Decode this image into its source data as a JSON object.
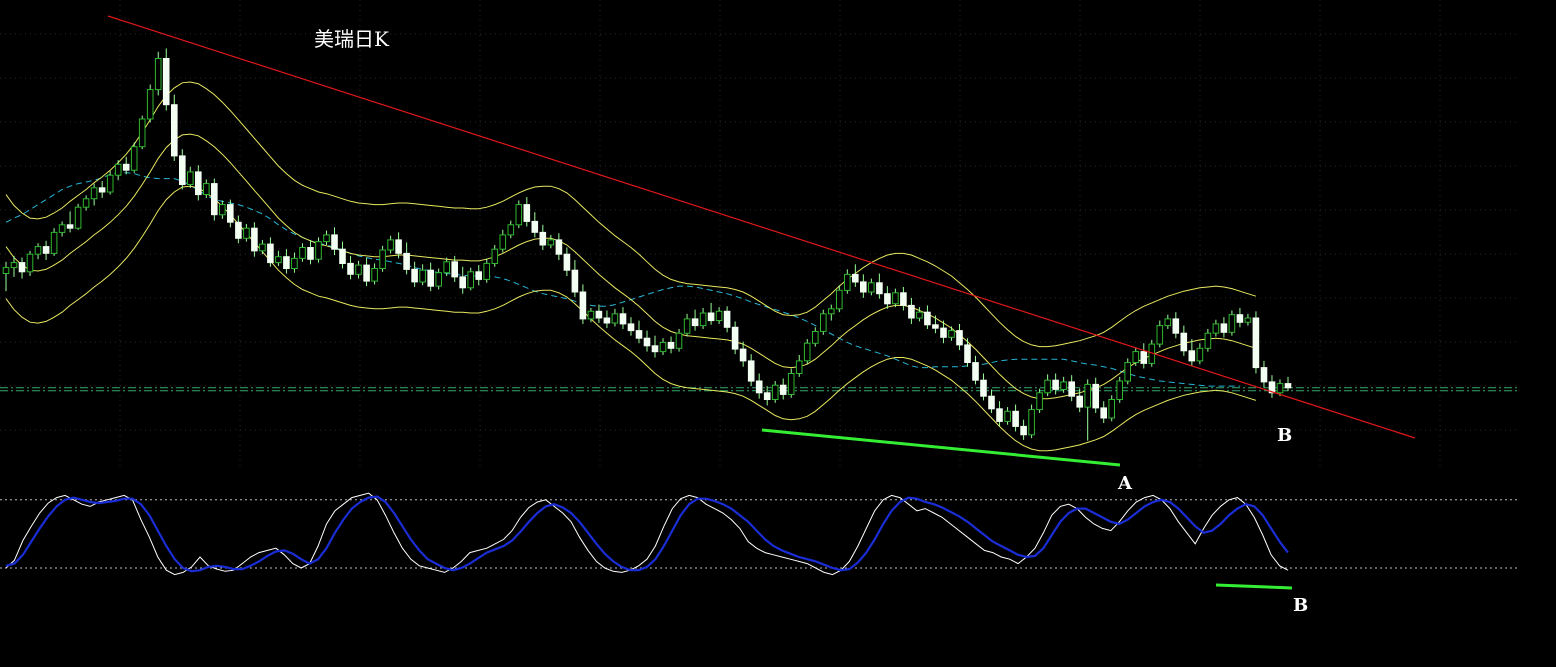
{
  "chart_data": {
    "type": "candlestick",
    "title": "美瑞日K",
    "annotations": {
      "main_a": "A",
      "main_b": "B",
      "osc_b": "B"
    },
    "colors": {
      "background": "#000000",
      "up_candle": "#2db82d",
      "down_candle": "#f2fff2",
      "wick": "#9aff9a",
      "bollinger_band": "#e8e860",
      "moving_average": "#26b6d6",
      "trendline": "#e01818",
      "divergence_line": "#33ee33",
      "oscillator_fast": "#ffffff",
      "oscillator_slow": "#1a2dd6",
      "grid": "#2a2a2a",
      "level_line": "#35a86b"
    },
    "candles": [
      [
        100.2,
        101.6,
        98.1,
        100.9
      ],
      [
        100.9,
        102.3,
        99.8,
        101.5
      ],
      [
        101.5,
        102.1,
        99.6,
        100.4
      ],
      [
        100.4,
        102.9,
        99.9,
        102.5
      ],
      [
        102.5,
        103.8,
        101.9,
        103.4
      ],
      [
        103.4,
        104.1,
        101.8,
        102.6
      ],
      [
        102.6,
        105.6,
        102.3,
        105.1
      ],
      [
        105.1,
        106.4,
        104.6,
        106.0
      ],
      [
        106.0,
        107.6,
        105.1,
        105.6
      ],
      [
        105.6,
        108.5,
        105.4,
        108.1
      ],
      [
        108.1,
        109.5,
        107.7,
        109.1
      ],
      [
        109.1,
        110.9,
        108.3,
        110.4
      ],
      [
        110.4,
        111.2,
        109.2,
        109.9
      ],
      [
        109.9,
        112.4,
        109.6,
        111.9
      ],
      [
        111.9,
        113.7,
        111.3,
        113.2
      ],
      [
        113.2,
        114.1,
        112.0,
        112.5
      ],
      [
        112.5,
        115.8,
        112.2,
        115.3
      ],
      [
        115.3,
        119.0,
        115.0,
        118.6
      ],
      [
        118.6,
        122.7,
        118.2,
        122.1
      ],
      [
        122.1,
        126.6,
        121.4,
        125.8
      ],
      [
        125.8,
        127.0,
        119.6,
        120.3
      ],
      [
        120.3,
        121.5,
        113.6,
        114.2
      ],
      [
        114.2,
        115.0,
        110.2,
        110.8
      ],
      [
        110.8,
        112.9,
        110.4,
        112.3
      ],
      [
        112.3,
        113.1,
        108.9,
        109.6
      ],
      [
        109.6,
        111.4,
        109.2,
        110.9
      ],
      [
        110.9,
        111.5,
        106.5,
        107.2
      ],
      [
        107.2,
        108.9,
        106.7,
        108.4
      ],
      [
        108.4,
        109.0,
        105.7,
        106.3
      ],
      [
        106.3,
        107.1,
        103.8,
        104.4
      ],
      [
        104.4,
        106.1,
        104.0,
        105.6
      ],
      [
        105.6,
        106.3,
        102.2,
        102.9
      ],
      [
        102.9,
        104.2,
        102.5,
        103.7
      ],
      [
        103.7,
        104.5,
        101.0,
        101.5
      ],
      [
        101.5,
        102.9,
        101.1,
        102.2
      ],
      [
        102.2,
        103.1,
        100.2,
        100.8
      ],
      [
        100.8,
        102.7,
        100.3,
        102.0
      ],
      [
        102.0,
        103.8,
        101.6,
        103.3
      ],
      [
        103.3,
        104.2,
        101.3,
        101.9
      ],
      [
        101.9,
        104.5,
        101.5,
        104.0
      ],
      [
        104.0,
        105.3,
        103.6,
        104.8
      ],
      [
        104.8,
        105.7,
        102.4,
        103.1
      ],
      [
        103.1,
        104.0,
        100.8,
        101.4
      ],
      [
        101.4,
        102.3,
        99.5,
        100.1
      ],
      [
        100.1,
        101.7,
        99.6,
        101.2
      ],
      [
        101.2,
        102.1,
        98.7,
        99.3
      ],
      [
        99.3,
        101.4,
        98.9,
        100.8
      ],
      [
        100.8,
        103.5,
        100.4,
        103.0
      ],
      [
        103.0,
        104.7,
        102.6,
        104.2
      ],
      [
        104.2,
        105.1,
        102.0,
        102.6
      ],
      [
        102.6,
        103.9,
        100.1,
        100.7
      ],
      [
        100.7,
        101.6,
        98.6,
        99.2
      ],
      [
        99.2,
        101.3,
        98.8,
        100.6
      ],
      [
        100.6,
        101.5,
        98.1,
        98.7
      ],
      [
        98.7,
        100.8,
        98.3,
        100.3
      ],
      [
        100.3,
        102.1,
        99.9,
        101.6
      ],
      [
        101.6,
        102.3,
        99.2,
        99.8
      ],
      [
        99.8,
        101.0,
        97.8,
        98.5
      ],
      [
        98.5,
        100.9,
        98.2,
        100.4
      ],
      [
        100.4,
        101.2,
        98.8,
        99.5
      ],
      [
        99.5,
        102.0,
        99.1,
        101.4
      ],
      [
        101.4,
        103.6,
        101.0,
        103.1
      ],
      [
        103.1,
        105.4,
        102.7,
        104.8
      ],
      [
        104.8,
        106.5,
        104.4,
        106.0
      ],
      [
        106.0,
        108.9,
        105.6,
        108.4
      ],
      [
        108.4,
        109.3,
        105.8,
        106.4
      ],
      [
        106.4,
        107.5,
        104.5,
        105.1
      ],
      [
        105.1,
        106.0,
        103.0,
        103.6
      ],
      [
        103.6,
        104.8,
        103.2,
        104.2
      ],
      [
        104.2,
        105.0,
        101.8,
        102.5
      ],
      [
        102.5,
        103.3,
        99.9,
        100.6
      ],
      [
        100.6,
        101.8,
        97.4,
        98.0
      ],
      [
        98.0,
        98.9,
        94.2,
        94.8
      ],
      [
        94.8,
        96.1,
        94.4,
        95.7
      ],
      [
        95.7,
        96.5,
        94.3,
        94.9
      ],
      [
        94.9,
        95.8,
        93.7,
        94.3
      ],
      [
        94.3,
        96.0,
        93.9,
        95.4
      ],
      [
        95.4,
        96.2,
        93.6,
        94.2
      ],
      [
        94.2,
        95.0,
        92.8,
        93.4
      ],
      [
        93.4,
        94.6,
        91.9,
        92.5
      ],
      [
        92.5,
        93.4,
        90.9,
        91.6
      ],
      [
        91.6,
        92.8,
        90.2,
        90.9
      ],
      [
        90.9,
        92.5,
        90.5,
        92.0
      ],
      [
        92.0,
        92.7,
        90.7,
        91.3
      ],
      [
        91.3,
        93.6,
        90.9,
        93.1
      ],
      [
        93.1,
        95.4,
        92.7,
        94.8
      ],
      [
        94.8,
        95.9,
        93.4,
        94.0
      ],
      [
        94.0,
        96.1,
        93.6,
        95.5
      ],
      [
        95.5,
        96.7,
        94.1,
        94.6
      ],
      [
        94.6,
        96.2,
        94.2,
        95.7
      ],
      [
        95.7,
        96.3,
        93.2,
        93.8
      ],
      [
        93.8,
        94.5,
        90.6,
        91.2
      ],
      [
        91.2,
        92.1,
        89.1,
        89.8
      ],
      [
        89.8,
        90.6,
        86.8,
        87.4
      ],
      [
        87.4,
        88.3,
        85.3,
        86.0
      ],
      [
        86.0,
        86.8,
        84.5,
        85.2
      ],
      [
        85.2,
        87.4,
        84.8,
        86.9
      ],
      [
        86.9,
        87.7,
        85.2,
        85.8
      ],
      [
        85.8,
        88.9,
        85.4,
        88.3
      ],
      [
        88.3,
        90.5,
        87.9,
        89.8
      ],
      [
        89.8,
        92.4,
        89.4,
        91.9
      ],
      [
        91.9,
        93.8,
        91.5,
        93.3
      ],
      [
        93.3,
        95.9,
        92.9,
        95.4
      ],
      [
        95.4,
        96.5,
        94.6,
        96.0
      ],
      [
        96.0,
        98.8,
        95.6,
        98.2
      ],
      [
        98.2,
        100.7,
        97.8,
        100.1
      ],
      [
        100.1,
        101.3,
        98.6,
        99.2
      ],
      [
        99.2,
        100.1,
        97.3,
        98.0
      ],
      [
        98.0,
        99.6,
        97.6,
        99.1
      ],
      [
        99.1,
        100.2,
        97.2,
        97.8
      ],
      [
        97.8,
        98.7,
        96.0,
        96.6
      ],
      [
        96.6,
        98.4,
        96.2,
        97.9
      ],
      [
        97.9,
        98.6,
        95.8,
        96.4
      ],
      [
        96.4,
        97.3,
        94.2,
        94.9
      ],
      [
        94.9,
        96.2,
        94.5,
        95.6
      ],
      [
        95.6,
        96.4,
        93.6,
        94.1
      ],
      [
        94.1,
        95.2,
        93.1,
        93.7
      ],
      [
        93.7,
        94.6,
        91.9,
        92.6
      ],
      [
        92.6,
        93.9,
        92.2,
        93.4
      ],
      [
        93.4,
        94.2,
        91.1,
        91.7
      ],
      [
        91.7,
        92.5,
        89.1,
        89.6
      ],
      [
        89.6,
        90.4,
        87.0,
        87.5
      ],
      [
        87.5,
        88.3,
        85.1,
        85.6
      ],
      [
        85.6,
        86.4,
        83.6,
        84.1
      ],
      [
        84.1,
        85.0,
        82.0,
        82.6
      ],
      [
        82.6,
        84.3,
        82.2,
        83.8
      ],
      [
        83.8,
        84.6,
        81.4,
        82.0
      ],
      [
        82.0,
        82.8,
        80.4,
        81.0
      ],
      [
        81.0,
        84.6,
        80.6,
        84.0
      ],
      [
        84.0,
        86.5,
        83.6,
        86.0
      ],
      [
        86.0,
        88.2,
        85.6,
        87.5
      ],
      [
        87.5,
        88.3,
        85.8,
        86.4
      ],
      [
        86.4,
        87.9,
        86.0,
        87.3
      ],
      [
        87.3,
        88.1,
        85.0,
        85.6
      ],
      [
        85.6,
        86.5,
        83.7,
        84.3
      ],
      [
        84.3,
        87.6,
        80.3,
        87.0
      ],
      [
        87.0,
        87.8,
        83.6,
        84.2
      ],
      [
        84.2,
        85.0,
        82.4,
        83.0
      ],
      [
        83.0,
        85.7,
        82.6,
        85.2
      ],
      [
        85.2,
        87.9,
        84.8,
        87.4
      ],
      [
        87.4,
        90.1,
        87.0,
        89.6
      ],
      [
        89.6,
        91.4,
        89.2,
        90.9
      ],
      [
        90.9,
        91.9,
        88.9,
        89.5
      ],
      [
        89.5,
        92.3,
        89.1,
        91.8
      ],
      [
        91.8,
        94.6,
        91.4,
        94.0
      ],
      [
        94.0,
        95.3,
        93.6,
        94.8
      ],
      [
        94.8,
        95.6,
        92.5,
        93.1
      ],
      [
        93.1,
        94.0,
        90.4,
        91.0
      ],
      [
        91.0,
        92.4,
        89.2,
        89.8
      ],
      [
        89.8,
        91.9,
        89.4,
        91.3
      ],
      [
        91.3,
        93.6,
        90.9,
        93.1
      ],
      [
        93.1,
        94.7,
        92.7,
        94.2
      ],
      [
        94.2,
        95.0,
        92.6,
        93.2
      ],
      [
        93.2,
        95.8,
        92.8,
        95.3
      ],
      [
        95.3,
        96.1,
        93.8,
        94.4
      ],
      [
        94.4,
        95.4,
        94.0,
        94.9
      ],
      [
        94.9,
        95.7,
        88.3,
        89.0
      ],
      [
        89.0,
        89.8,
        86.6,
        87.3
      ],
      [
        87.3,
        88.1,
        85.4,
        86.0
      ],
      [
        86.0,
        87.6,
        85.6,
        87.1
      ],
      [
        87.1,
        87.9,
        86.2,
        86.6
      ]
    ],
    "ma_mid": [
      106.3,
      106.8,
      107.2,
      107.8,
      108.4,
      109.0,
      109.6,
      110.2,
      110.6,
      110.9,
      111.1,
      111.3,
      111.6,
      112.0,
      112.2,
      112.2,
      112.1,
      111.8,
      111.6,
      111.5,
      111.5,
      111.5,
      111.2,
      110.7,
      110.1,
      109.5,
      109.0,
      108.8,
      108.6,
      108.4,
      108.1,
      107.7,
      107.3,
      106.7,
      106.0,
      105.4,
      104.9,
      104.5,
      104.1,
      103.8,
      103.6,
      103.3,
      103.0,
      102.6,
      102.3,
      102.1,
      101.9,
      101.8,
      101.6,
      101.4,
      101.2,
      100.9,
      100.7,
      100.5,
      100.3,
      100.2,
      100.1,
      100.0,
      99.9,
      99.9,
      99.9,
      99.8,
      99.6,
      99.3,
      98.9,
      98.5,
      98.1,
      97.8,
      97.6,
      97.4,
      97.2,
      96.9,
      96.6,
      96.4,
      96.3,
      96.3,
      96.5,
      96.8,
      97.1,
      97.4,
      97.7,
      98.0,
      98.3,
      98.5,
      98.7,
      98.7,
      98.6,
      98.4,
      98.2,
      98.0,
      97.8,
      97.5,
      97.2,
      96.8,
      96.5,
      96.2,
      95.9,
      95.6,
      95.3,
      94.9,
      94.5,
      94.0,
      93.5,
      93.0,
      92.5,
      92.0,
      91.6,
      91.3,
      91.0,
      90.7,
      90.4,
      90.0,
      89.6,
      89.2,
      89.0,
      89.0,
      89.1,
      89.1,
      89.1,
      89.1,
      89.2,
      89.3,
      89.4,
      89.6,
      89.8,
      89.9,
      90.0,
      90.0,
      90.0,
      90.0,
      90.0,
      90.0,
      90.0,
      89.8,
      89.6,
      89.4,
      89.3,
      89.1,
      88.9,
      88.6,
      88.3,
      88.0,
      87.8,
      87.6,
      87.4,
      87.3,
      87.2,
      87.1,
      87.0,
      86.9,
      86.8,
      86.8,
      86.8,
      86.8,
      86.8
    ],
    "boll_mid": [
      103.4,
      102.1,
      101.2,
      100.6,
      100.5,
      100.7,
      101.2,
      101.8,
      102.6,
      103.3,
      104.0,
      104.8,
      105.5,
      106.3,
      107.2,
      108.2,
      109.4,
      110.8,
      112.3,
      113.9,
      115.2,
      116.1,
      116.7,
      116.8,
      116.6,
      116.0,
      115.3,
      114.4,
      113.4,
      112.3,
      111.2,
      110.1,
      109.0,
      107.9,
      106.8,
      105.9,
      105.1,
      104.5,
      104.1,
      103.7,
      103.5,
      103.2,
      102.9,
      102.6,
      102.4,
      102.3,
      102.2,
      102.2,
      102.3,
      102.4,
      102.4,
      102.3,
      102.2,
      102.1,
      102.0,
      101.9,
      101.8,
      101.8,
      101.7,
      101.7,
      101.9,
      102.2,
      102.6,
      103.1,
      103.6,
      104.0,
      104.3,
      104.4,
      104.4,
      104.1,
      103.6,
      102.8,
      101.9,
      101.0,
      100.1,
      99.3,
      98.5,
      97.8,
      97.1,
      96.3,
      95.4,
      94.5,
      93.8,
      93.3,
      93.0,
      92.8,
      92.7,
      92.6,
      92.5,
      92.4,
      92.3,
      92.1,
      91.8,
      91.3,
      90.7,
      90.1,
      89.5,
      89.1,
      89.0,
      89.1,
      89.4,
      90.0,
      90.8,
      91.6,
      92.5,
      93.3,
      94.0,
      94.7,
      95.3,
      95.8,
      96.2,
      96.4,
      96.4,
      96.2,
      95.8,
      95.4,
      94.9,
      94.3,
      93.7,
      92.9,
      92.1,
      91.2,
      90.2,
      89.2,
      88.2,
      87.3,
      86.5,
      85.9,
      85.5,
      85.3,
      85.3,
      85.4,
      85.6,
      85.8,
      86.0,
      86.3,
      86.6,
      87.0,
      87.6,
      88.3,
      89.0,
      89.6,
      90.1,
      90.5,
      90.9,
      91.3,
      91.6,
      91.9,
      92.1,
      92.3,
      92.4,
      92.5,
      92.4,
      92.2,
      91.9,
      91.6,
      91.3
    ],
    "osc_fast": [
      20,
      27,
      45,
      58,
      70,
      79,
      84,
      86,
      82,
      78,
      76,
      80,
      82,
      84,
      86,
      82,
      64,
      48,
      30,
      18,
      14,
      16,
      21,
      30,
      22,
      19,
      17,
      18,
      24,
      30,
      34,
      36,
      38,
      32,
      24,
      20,
      24,
      40,
      60,
      72,
      78,
      84,
      86,
      88,
      82,
      68,
      52,
      38,
      28,
      22,
      20,
      18,
      16,
      20,
      26,
      34,
      36,
      38,
      42,
      46,
      54,
      66,
      75,
      80,
      82,
      76,
      70,
      62,
      48,
      36,
      26,
      20,
      17,
      16,
      18,
      22,
      28,
      40,
      58,
      74,
      83,
      86,
      84,
      78,
      74,
      70,
      64,
      56,
      44,
      38,
      34,
      32,
      30,
      28,
      26,
      24,
      20,
      16,
      14,
      18,
      26,
      40,
      56,
      72,
      82,
      86,
      84,
      78,
      72,
      74,
      70,
      66,
      60,
      54,
      48,
      42,
      36,
      34,
      30,
      28,
      24,
      30,
      38,
      52,
      68,
      76,
      78,
      74,
      66,
      60,
      56,
      54,
      62,
      72,
      80,
      84,
      86,
      82,
      74,
      62,
      52,
      42,
      56,
      68,
      76,
      82,
      84,
      78,
      66,
      50,
      32,
      22,
      18
    ],
    "osc_slow": [
      22,
      24,
      32,
      44,
      56,
      67,
      76,
      82,
      84,
      82,
      80,
      79,
      80,
      81,
      83,
      83,
      78,
      68,
      54,
      40,
      28,
      20,
      17,
      18,
      21,
      22,
      21,
      19,
      19,
      22,
      26,
      31,
      35,
      36,
      33,
      28,
      24,
      28,
      38,
      52,
      64,
      74,
      80,
      84,
      85,
      80,
      70,
      58,
      46,
      36,
      28,
      24,
      20,
      18,
      20,
      24,
      29,
      34,
      37,
      40,
      45,
      53,
      62,
      70,
      76,
      78,
      75,
      70,
      62,
      52,
      42,
      33,
      26,
      21,
      18,
      18,
      21,
      28,
      40,
      54,
      68,
      78,
      83,
      83,
      81,
      78,
      74,
      68,
      62,
      54,
      46,
      40,
      36,
      33,
      30,
      28,
      26,
      23,
      20,
      18,
      19,
      25,
      34,
      46,
      60,
      72,
      80,
      84,
      83,
      80,
      78,
      75,
      71,
      67,
      62,
      56,
      50,
      44,
      40,
      36,
      32,
      30,
      31,
      38,
      50,
      62,
      70,
      74,
      74,
      70,
      66,
      62,
      60,
      64,
      70,
      76,
      80,
      82,
      80,
      74,
      66,
      58,
      52,
      54,
      60,
      68,
      74,
      78,
      76,
      68,
      56,
      44,
      34
    ]
  }
}
